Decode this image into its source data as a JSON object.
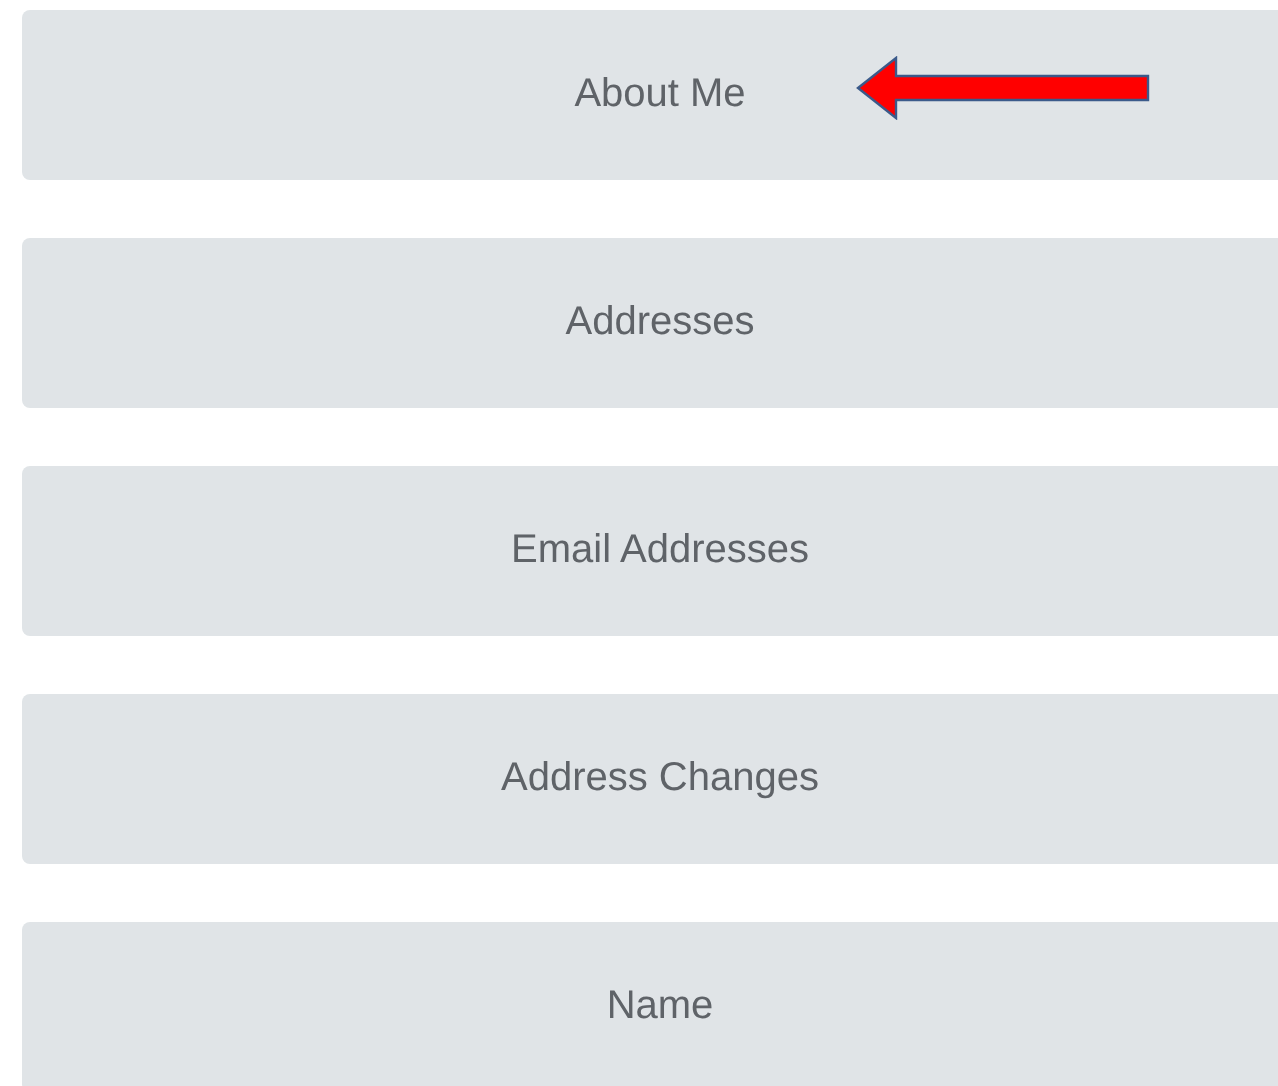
{
  "menu_items": [
    {
      "label": "About Me",
      "arrow": true
    },
    {
      "label": "Addresses",
      "arrow": false
    },
    {
      "label": "Email Addresses",
      "arrow": false
    },
    {
      "label": "Address Changes",
      "arrow": false
    },
    {
      "label": "Name",
      "arrow": false
    }
  ]
}
